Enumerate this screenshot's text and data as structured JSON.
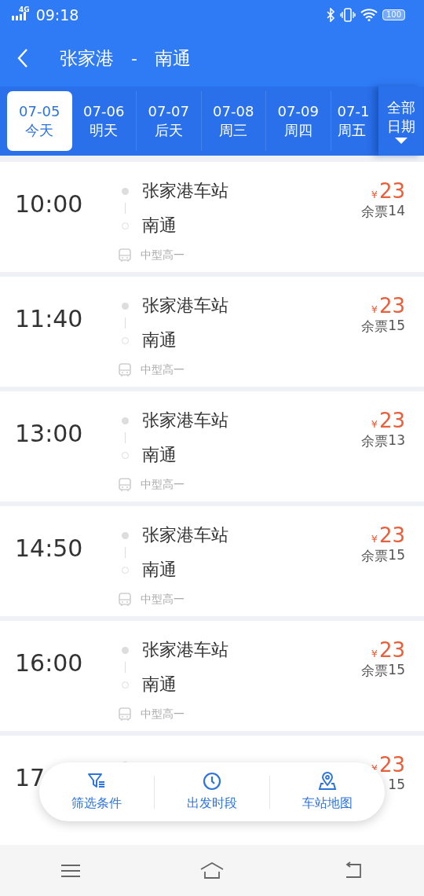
{
  "status_bar": {
    "network": "4G",
    "time": "09:18",
    "battery": "100"
  },
  "header": {
    "title_from": "张家港",
    "separator": "-",
    "title_to": "南通"
  },
  "date_tabs": [
    {
      "date": "07-05",
      "day": "今天",
      "selected": true
    },
    {
      "date": "07-06",
      "day": "明天",
      "selected": false
    },
    {
      "date": "07-07",
      "day": "后天",
      "selected": false
    },
    {
      "date": "07-08",
      "day": "周三",
      "selected": false
    },
    {
      "date": "07-09",
      "day": "周四",
      "selected": false
    },
    {
      "date": "07-1",
      "day": "周五",
      "selected": false
    }
  ],
  "all_dates_button": {
    "line1": "全部",
    "line2": "日期"
  },
  "trips": [
    {
      "time": "10:00",
      "from": "张家港车站",
      "to": "南通",
      "bus_type": "中型高一",
      "currency": "¥",
      "price": "23",
      "remaining_label": "余票",
      "remaining": "14"
    },
    {
      "time": "11:40",
      "from": "张家港车站",
      "to": "南通",
      "bus_type": "中型高一",
      "currency": "¥",
      "price": "23",
      "remaining_label": "余票",
      "remaining": "15"
    },
    {
      "time": "13:00",
      "from": "张家港车站",
      "to": "南通",
      "bus_type": "中型高一",
      "currency": "¥",
      "price": "23",
      "remaining_label": "余票",
      "remaining": "13"
    },
    {
      "time": "14:50",
      "from": "张家港车站",
      "to": "南通",
      "bus_type": "中型高一",
      "currency": "¥",
      "price": "23",
      "remaining_label": "余票",
      "remaining": "15"
    },
    {
      "time": "16:00",
      "from": "张家港车站",
      "to": "南通",
      "bus_type": "中型高一",
      "currency": "¥",
      "price": "23",
      "remaining_label": "余票",
      "remaining": "15"
    },
    {
      "time": "17",
      "currency": "¥",
      "price": "23",
      "remaining": "15"
    }
  ],
  "action_bar": [
    {
      "kind": "filter",
      "label": "筛选条件"
    },
    {
      "kind": "clock",
      "label": "出发时段"
    },
    {
      "kind": "map",
      "label": "车站地图"
    }
  ]
}
